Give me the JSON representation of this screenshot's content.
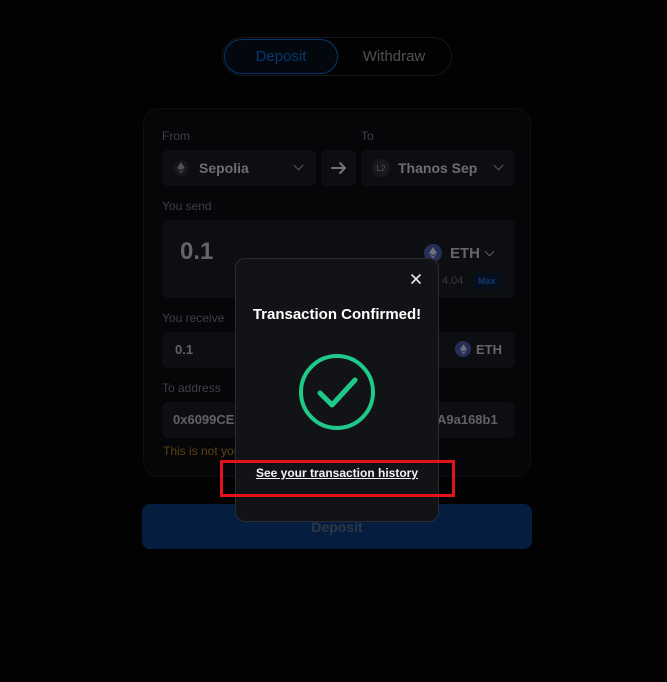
{
  "tabs": {
    "deposit": "Deposit",
    "withdraw": "Withdraw"
  },
  "form": {
    "from_label": "From",
    "to_label": "To",
    "from_network": "Sepolia",
    "to_network": "Thanos Sep",
    "to_network_badge": "L2",
    "you_send_label": "You send",
    "send_amount": "0.1",
    "send_token": "ETH",
    "balance_fragment": "4.04",
    "max_label": "Max",
    "you_receive_label": "You receive",
    "receive_amount": "0.1",
    "receive_token": "ETH",
    "to_address_label": "To address",
    "address_start": "0x6099CE",
    "address_end": "A9a168b1",
    "warning_fragment": "This is not you"
  },
  "submit_label": "Deposit",
  "modal": {
    "title": "Transaction Confirmed!",
    "history_link": "See your transaction history"
  },
  "colors": {
    "accent": "#0f6fdc",
    "success": "#1fc98a",
    "warning": "#b8862a",
    "highlight": "#e0141a"
  },
  "icons": [
    "ethereum-icon",
    "arrow-right-icon",
    "chevron-down-icon",
    "close-icon",
    "check-circle-icon"
  ]
}
